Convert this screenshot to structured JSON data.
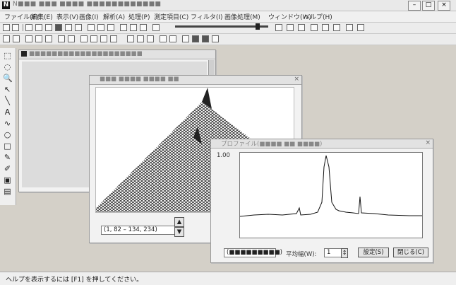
{
  "app": {
    "title": "N■■■ ■■■ ■■■■ ■■■■■■■■■■■■"
  },
  "menu": [
    "ファイル(F)",
    "編集(E)",
    "表示(V)",
    "画像(I)",
    "解析(A)",
    "処理(P)",
    "測定項目(C)",
    "フィルタ(I)",
    "画像処理(M)",
    "ウィンドウ(W)",
    "ヘルプ(H)"
  ],
  "window_controls": {
    "minimize": "–",
    "maximize": "□",
    "close": "×"
  },
  "tools": [
    {
      "name": "select-tool",
      "glyph": "⬚"
    },
    {
      "name": "lasso-tool",
      "glyph": "◌"
    },
    {
      "name": "zoom-tool",
      "glyph": "🔍"
    },
    {
      "name": "pointer-tool",
      "glyph": "↖"
    },
    {
      "name": "line-tool",
      "glyph": "╲"
    },
    {
      "name": "text-tool",
      "glyph": "A"
    },
    {
      "name": "curve-tool",
      "glyph": "∿"
    },
    {
      "name": "ellipse-tool",
      "glyph": "○"
    },
    {
      "name": "rect-tool",
      "glyph": "□"
    },
    {
      "name": "pencil-tool",
      "glyph": "✎"
    },
    {
      "name": "brush-tool",
      "glyph": "✐"
    },
    {
      "name": "fill-tool",
      "glyph": "▣"
    },
    {
      "name": "palette-tool",
      "glyph": "▤"
    }
  ],
  "windows": {
    "back": {
      "title": "■■■■■■■■■■■■■■■■■■■■"
    },
    "middle": {
      "title": "■■■ ■■■■ ■■■■ ■■",
      "coord": "(1, 82 – 134, 234)"
    },
    "front": {
      "title": "プロファイル(■■■■ ■■ ■■■■)",
      "y_label": "1.00",
      "bottom_left": "(■■■■■■■■■)",
      "sample_label": "平均幅(W):",
      "sample_value": "1",
      "ok_label": "設定(S)",
      "cancel_label": "閉じる(C)"
    }
  },
  "statusbar": {
    "text": "ヘルプを表示するには [F1] を押してください。"
  }
}
